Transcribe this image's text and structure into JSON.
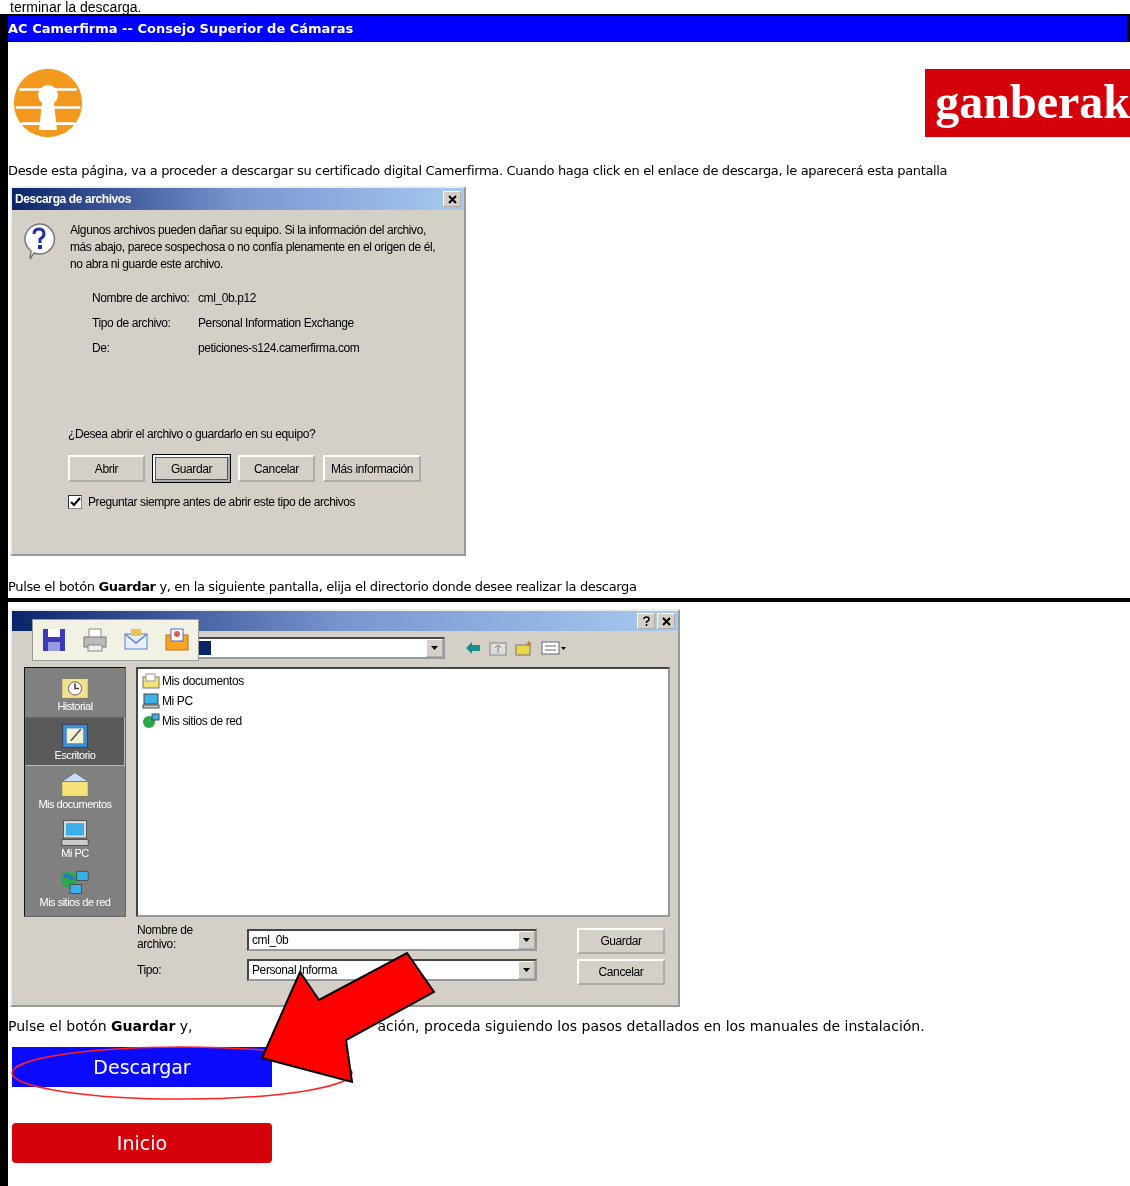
{
  "top_text": "terminar la descarga.",
  "window": {
    "title": "AC Camerfirma -- Consejo Superior de Cámaras"
  },
  "header": {
    "logo_text": "ganberak"
  },
  "intro": "Desde esta página, va a proceder a descargar su certificado digital Camerfirma. Cuando haga click en el enlace de descarga, le aparecerá esta pantalla",
  "download_dialog": {
    "title": "Descarga de archivos",
    "message": "Algunos archivos pueden dañar su equipo. Si la información del archivo, más abajo, parece sospechosa o no confía plenamente en el origen de él, no abra ni guarde este archivo.",
    "fields": [
      {
        "label": "Nombre de archivo:",
        "value": "cml_0b.p12"
      },
      {
        "label": "Tipo de archivo:",
        "value": "Personal Information Exchange"
      },
      {
        "label": "De:",
        "value": "peticiones-s124.camerfirma.com"
      }
    ],
    "question": "¿Desea abrir el archivo o guardarlo en su equipo?",
    "buttons": [
      {
        "label": "Abrir",
        "default": false
      },
      {
        "label": "Guardar",
        "default": true
      },
      {
        "label": "Cancelar",
        "default": false
      },
      {
        "label": "Más información",
        "default": false
      }
    ],
    "checkbox": {
      "label": "Preguntar siempre antes de abrir este tipo de archivos",
      "checked": true
    }
  },
  "step_text": "Pulse el botón **Guardar** y, en la siguiente pantalla, elija el directorio donde desee realizar la descarga",
  "save_dialog": {
    "places": [
      {
        "label": "Historial",
        "kind": "history",
        "selected": false
      },
      {
        "label": "Escritorio",
        "kind": "desktop",
        "selected": true
      },
      {
        "label": "Mis documentos",
        "kind": "documents",
        "selected": false
      },
      {
        "label": "Mi PC",
        "kind": "computer",
        "selected": false
      },
      {
        "label": "Mis sitios de red",
        "kind": "network",
        "selected": false
      }
    ],
    "files": [
      {
        "label": "Mis documentos",
        "kind": "documents"
      },
      {
        "label": "Mi PC",
        "kind": "computer"
      },
      {
        "label": "Mis sitios de red",
        "kind": "network"
      }
    ],
    "filename_label": "Nombre de archivo:",
    "filename": "cml_0b",
    "type_label": "Tipo:",
    "type": "Personal Informa",
    "buttons": [
      {
        "label": "Guardar"
      },
      {
        "label": "Cancelar"
      }
    ]
  },
  "final_text": {
    "before": "Pulse el botón **Guardar** y,",
    "after": "ación, proceda siguiendo los pasos detallados en los manuales de instalación."
  },
  "buttons": [
    {
      "label": "Descargar",
      "kind": "download"
    },
    {
      "label": "Inicio",
      "kind": "home"
    }
  ]
}
